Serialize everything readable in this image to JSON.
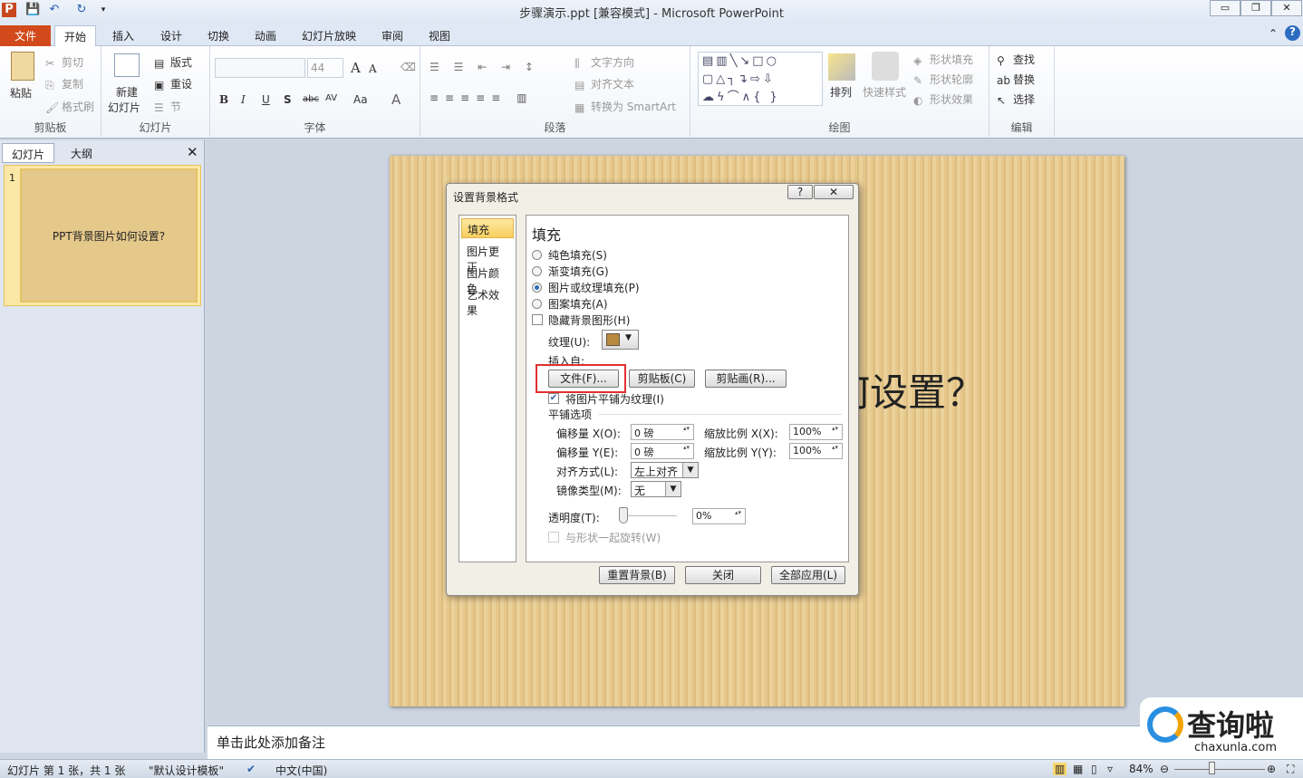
{
  "window": {
    "title": "步骤演示.ppt [兼容模式] - Microsoft PowerPoint",
    "app_icon": "P"
  },
  "tabs": [
    "文件",
    "开始",
    "插入",
    "设计",
    "切换",
    "动画",
    "幻灯片放映",
    "审阅",
    "视图"
  ],
  "ribbon": {
    "clipboard": {
      "label": "剪贴板",
      "paste": "粘贴",
      "cut": "剪切",
      "copy": "复制",
      "format_painter": "格式刷"
    },
    "slides": {
      "label": "幻灯片",
      "new_slide_1": "新建",
      "new_slide_2": "幻灯片",
      "layout": "版式",
      "reset": "重设",
      "section": "节"
    },
    "font": {
      "label": "字体",
      "font_name": "",
      "font_size": "44",
      "bold": "B",
      "italic": "I",
      "underline": "U",
      "shadow": "S",
      "strike": "abc",
      "spacing": "AV",
      "case": "Aa",
      "color": "A",
      "grow": "A",
      "shrink": "A"
    },
    "paragraph": {
      "label": "段落",
      "text_direction": "文字方向",
      "align_text": "对齐文本",
      "smartart": "转换为 SmartArt"
    },
    "drawing": {
      "label": "绘图",
      "arrange": "排列",
      "quick_styles": "快速样式",
      "shape_fill": "形状填充",
      "shape_outline": "形状轮廓",
      "shape_effects": "形状效果"
    },
    "editing": {
      "label": "编辑",
      "find": "查找",
      "replace": "替换",
      "select": "选择"
    }
  },
  "left_pane": {
    "tabs": [
      "幻灯片",
      "大纲"
    ],
    "slide_number": "1",
    "thumb_title": "PPT背景图片如何设置?"
  },
  "slide": {
    "title": "PPT背景图片如何设置？"
  },
  "notes": {
    "placeholder": "单击此处添加备注"
  },
  "status": {
    "slide_info": "幻灯片 第 1 张，共 1 张",
    "theme": "\"默认设计模板\"",
    "language": "中文(中国)",
    "zoom": "84%",
    "zoom_level": 84
  },
  "dialog": {
    "title": "设置背景格式",
    "help": "?",
    "close": "✕",
    "nav": [
      "填充",
      "图片更正",
      "图片颜色",
      "艺术效果"
    ],
    "heading": "填充",
    "options": [
      "纯色填充(S)",
      "渐变填充(G)",
      "图片或纹理填充(P)",
      "图案填充(A)"
    ],
    "selected_option": 2,
    "hide_bg_graphics": "隐藏背景图形(H)",
    "texture_label": "纹理(U):",
    "insert_from": "插入自:",
    "file_btn": "文件(F)...",
    "clipboard_btn": "剪贴板(C)",
    "clipart_btn": "剪贴画(R)...",
    "tile_checkbox": "将图片平铺为纹理(I)",
    "tile_options": "平铺选项",
    "offset_x_label": "偏移量 X(O):",
    "offset_x": "0 磅",
    "offset_y_label": "偏移量 Y(E):",
    "offset_y": "0 磅",
    "scale_x_label": "缩放比例 X(X):",
    "scale_x": "100%",
    "scale_y_label": "缩放比例 Y(Y):",
    "scale_y": "100%",
    "align_label": "对齐方式(L):",
    "align": "左上对齐",
    "mirror_label": "镜像类型(M):",
    "mirror": "无",
    "transparency_label": "透明度(T):",
    "transparency": "0%",
    "rotate_label": "与形状一起旋转(W)",
    "reset_btn": "重置背景(B)",
    "close_btn": "关闭",
    "apply_all_btn": "全部应用(L)"
  },
  "watermark": {
    "text": "查询啦",
    "url": "chaxunla.com"
  },
  "colors": {
    "file_tab": "#d2491b",
    "highlight": "#e03030",
    "slide_bg": "#e6c88c"
  }
}
